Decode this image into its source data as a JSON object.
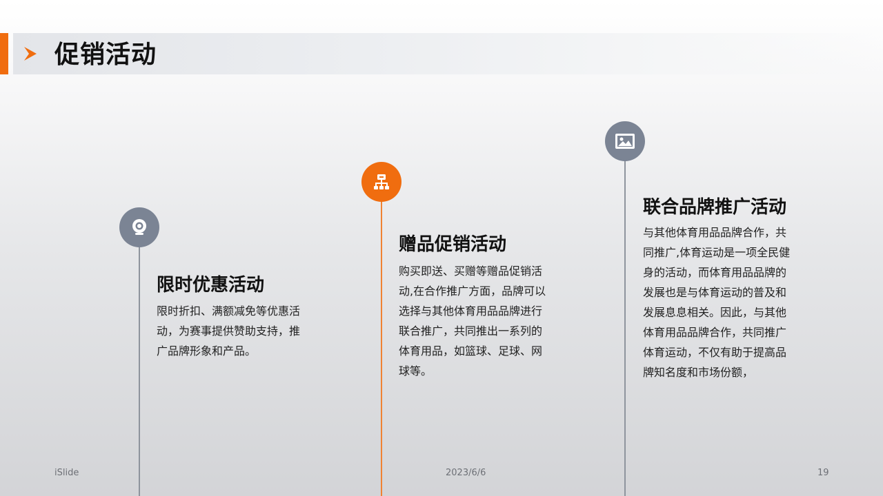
{
  "colors": {
    "accent": "#f06d0f",
    "node_gray": "#7b8494",
    "line_gray": "#8e949d",
    "line_orange": "#f08232"
  },
  "header": {
    "title": "促销活动",
    "icon": "chevron-right-icon"
  },
  "timeline": [
    {
      "title": "限时优惠活动",
      "body": "限时折扣、满额减免等优惠活动，为赛事提供赞助支持，推广品牌形象和产品。",
      "icon": "webcam-icon",
      "color": "#7b8494"
    },
    {
      "title": "赠品促销活动",
      "body": "购买即送、买赠等赠品促销活动,在合作推广方面，品牌可以选择与其他体育用品品牌进行联合推广，共同推出一系列的体育用品，如篮球、足球、网球等。",
      "icon": "org-chart-icon",
      "color": "#f06d0f"
    },
    {
      "title": "联合品牌推广活动",
      "body": "与其他体育用品品牌合作，共同推广,体育运动是一项全民健身的活动，而体育用品品牌的发展也是与体育运动的普及和发展息息相关。因此，与其他体育用品品牌合作，共同推广体育运动，不仅有助于提高品牌知名度和市场份额，",
      "icon": "image-icon",
      "color": "#7b8494"
    }
  ],
  "footer": {
    "left": "iSlide",
    "date": "2023/6/6",
    "page": "19"
  }
}
